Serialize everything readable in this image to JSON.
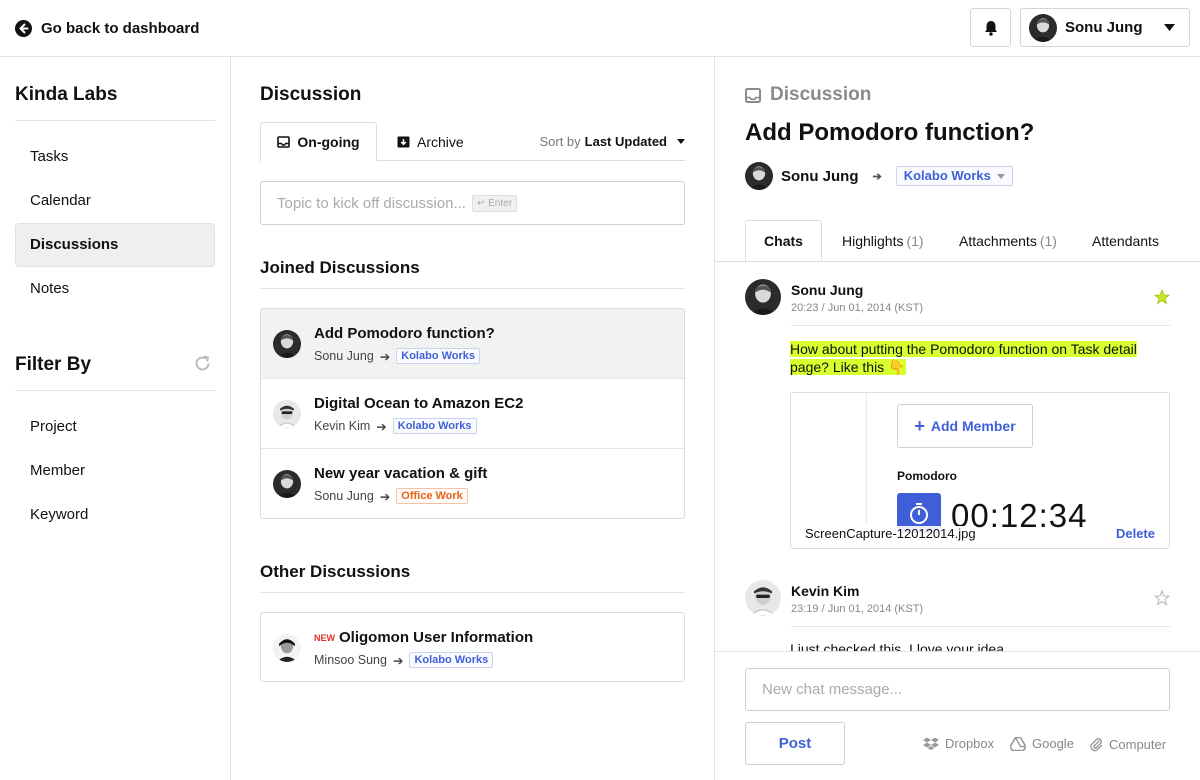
{
  "topbar": {
    "back_label": "Go back to dashboard",
    "user_name": "Sonu Jung"
  },
  "sidebar": {
    "org_name": "Kinda Labs",
    "nav": [
      {
        "label": "Tasks"
      },
      {
        "label": "Calendar"
      },
      {
        "label": "Discussions",
        "active": true
      },
      {
        "label": "Notes"
      }
    ],
    "filter_title": "Filter By",
    "filters": [
      {
        "label": "Project"
      },
      {
        "label": "Member"
      },
      {
        "label": "Keyword"
      }
    ]
  },
  "discussion_list": {
    "title": "Discussion",
    "tabs": [
      {
        "label": "On-going",
        "active": true
      },
      {
        "label": "Archive"
      }
    ],
    "sort_prefix": "Sort by",
    "sort_value": "Last Updated",
    "topic_placeholder": "Topic to kick off discussion...",
    "enter_hint": "↵ Enter",
    "joined_title": "Joined Discussions",
    "joined": [
      {
        "title": "Add Pomodoro function?",
        "author": "Sonu Jung",
        "project": "Kolabo Works",
        "tag_color": "blue",
        "selected": true
      },
      {
        "title": "Digital Ocean to Amazon EC2",
        "author": "Kevin Kim",
        "project": "Kolabo Works",
        "tag_color": "blue"
      },
      {
        "title": "New year vacation & gift",
        "author": "Sonu Jung",
        "project": "Office Work",
        "tag_color": "orange"
      }
    ],
    "other_title": "Other Discussions",
    "other": [
      {
        "badge": "NEW",
        "title": "Oligomon User Information",
        "author": "Minsoo Sung",
        "project": "Kolabo Works",
        "tag_color": "blue"
      }
    ]
  },
  "detail": {
    "header": "Discussion",
    "title": "Add Pomodoro function?",
    "author": "Sonu Jung",
    "project": "Kolabo Works",
    "tabs": [
      {
        "label": "Chats",
        "count": ""
      },
      {
        "label": "Highlights",
        "count": "(1)"
      },
      {
        "label": "Attachments",
        "count": "(1)"
      },
      {
        "label": "Attendants",
        "count": ""
      }
    ],
    "messages": [
      {
        "author": "Sonu Jung",
        "time": "20:23 / Jun 01, 2014 (KST)",
        "starred": true,
        "text": "How about putting the Pomodoro function on Task detail page? Like this 👇"
      },
      {
        "author": "Kevin Kim",
        "time": "23:19 / Jun 01, 2014 (KST)",
        "starred": false,
        "text": "I just checked this. I love your idea."
      }
    ],
    "attachment": {
      "add_member": "Add Member",
      "pomodoro_label": "Pomodoro",
      "timer": "00:12:34",
      "filename": "ScreenCapture-12012014.jpg",
      "delete_label": "Delete"
    },
    "composer": {
      "placeholder": "New chat message...",
      "post_label": "Post",
      "sources": [
        "Dropbox",
        "Google",
        "Computer"
      ]
    }
  },
  "colors": {
    "accent": "#3f5fd8",
    "orange": "#e8621b",
    "highlight": "#d8ff2e",
    "star": "#c7e82a"
  }
}
